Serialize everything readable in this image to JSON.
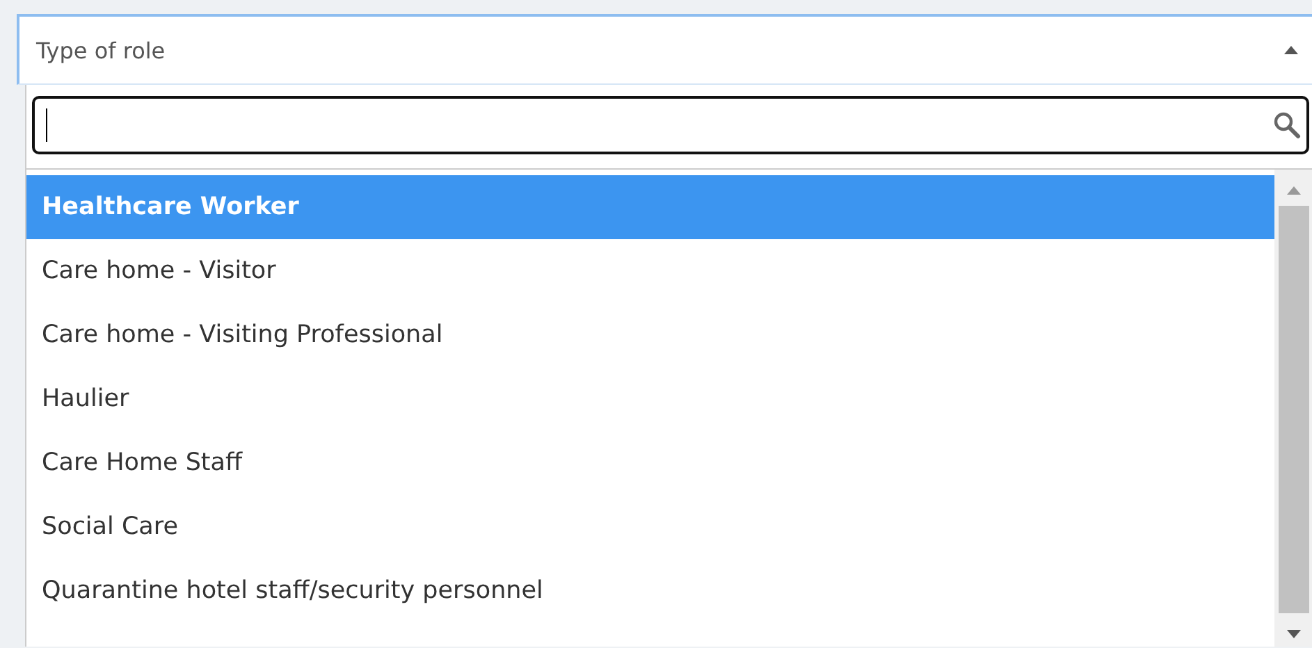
{
  "select": {
    "placeholder": "Type of role",
    "expanded": true
  },
  "options": [
    {
      "label": "Healthcare Worker",
      "selected": true
    },
    {
      "label": "Care home - Visitor",
      "selected": false
    },
    {
      "label": "Care home - Visiting Professional",
      "selected": false
    },
    {
      "label": "Haulier",
      "selected": false
    },
    {
      "label": "Care Home Staff",
      "selected": false
    },
    {
      "label": "Social Care",
      "selected": false
    },
    {
      "label": "Quarantine hotel staff/security personnel",
      "selected": false
    }
  ]
}
